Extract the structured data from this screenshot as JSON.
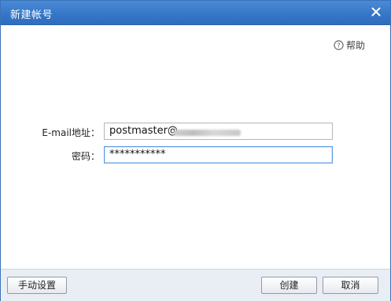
{
  "window": {
    "title": "新建帐号"
  },
  "help": {
    "label": "帮助",
    "icon": "help-circle-icon"
  },
  "form": {
    "email_label": "E-mail地址：",
    "email_value": "postmaster@",
    "password_label": "密码：",
    "password_value": "***********"
  },
  "footer": {
    "manual_settings_label": "手动设置",
    "create_label": "创建",
    "cancel_label": "取消"
  },
  "colors": {
    "titlebar": "#3677c8",
    "focus_border": "#5c9ae0",
    "footer_bg": "#e9eef4"
  }
}
